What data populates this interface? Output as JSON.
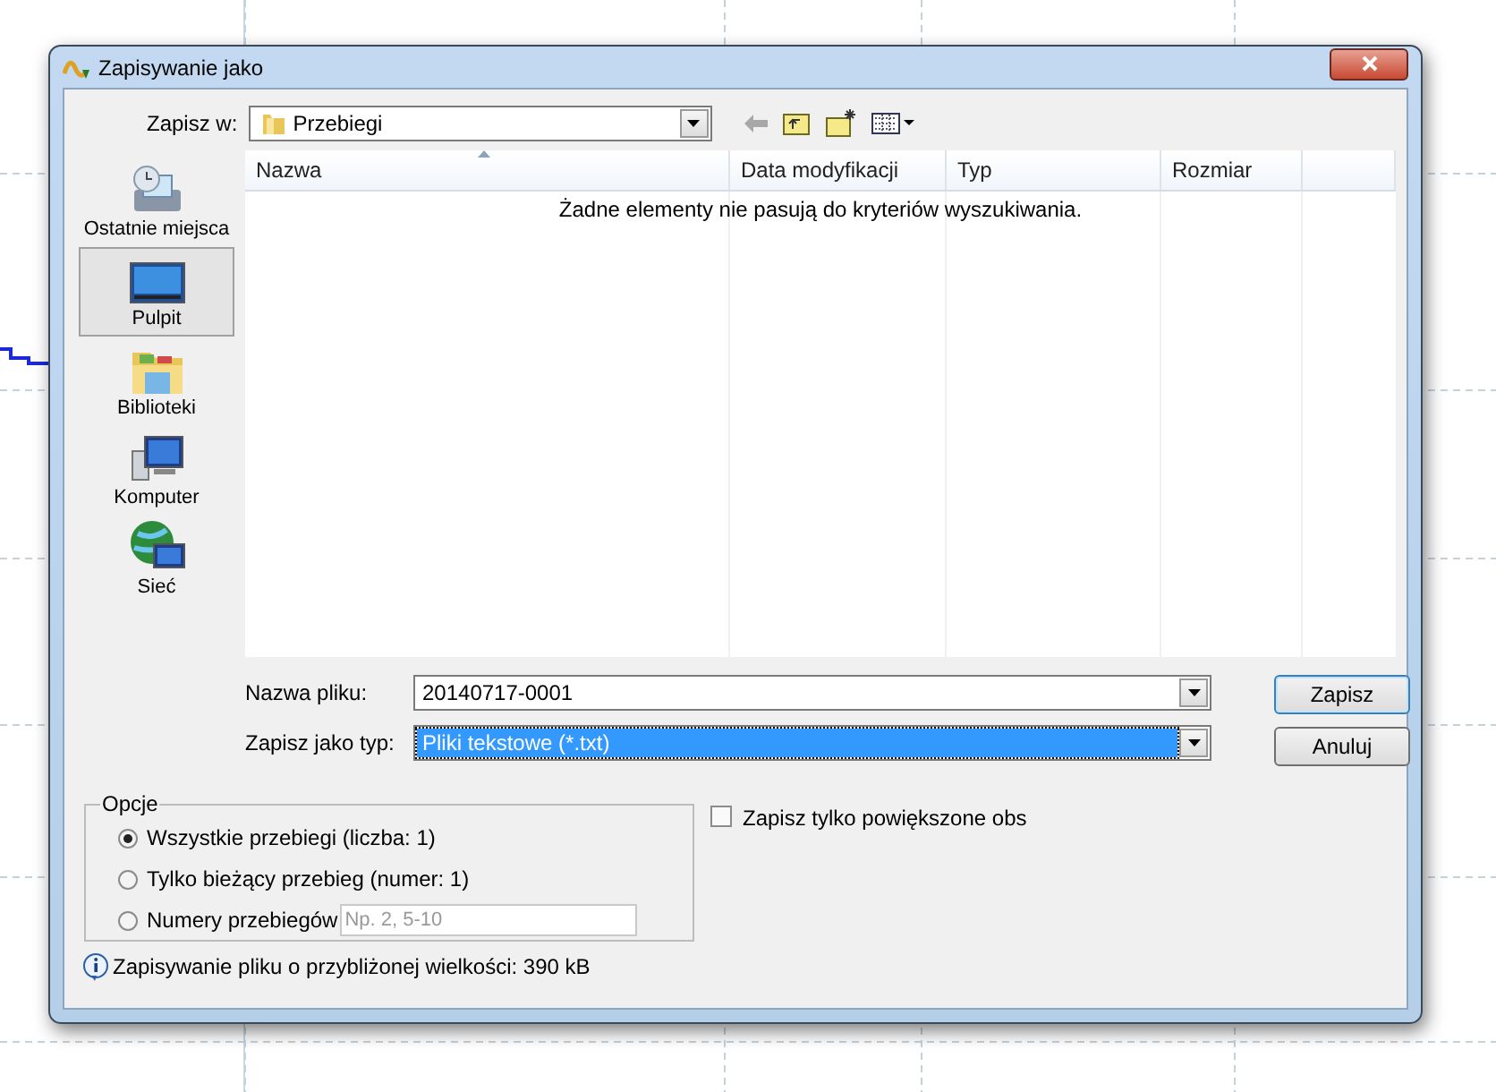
{
  "window": {
    "title": "Zapisywanie jako"
  },
  "save_in": {
    "label": "Zapisz w:",
    "value": "Przebiegi"
  },
  "places": [
    {
      "label": "Ostatnie miejsca",
      "kind": "recent",
      "selected": false
    },
    {
      "label": "Pulpit",
      "kind": "desktop",
      "selected": true
    },
    {
      "label": "Biblioteki",
      "kind": "libraries",
      "selected": false
    },
    {
      "label": "Komputer",
      "kind": "computer",
      "selected": false
    },
    {
      "label": "Sieć",
      "kind": "network",
      "selected": false
    }
  ],
  "file_list": {
    "columns": [
      {
        "label": "Nazwa",
        "sorted": true
      },
      {
        "label": "Data modyfikacji",
        "sorted": false
      },
      {
        "label": "Typ",
        "sorted": false
      },
      {
        "label": "Rozmiar",
        "sorted": false
      }
    ],
    "empty_message": "Żadne elementy nie pasują do kryteriów wyszukiwania."
  },
  "file_name": {
    "label": "Nazwa pliku:",
    "value": "20140717-0001"
  },
  "file_type": {
    "label": "Zapisz jako typ:",
    "value": "Pliki tekstowe (*.txt)",
    "focused": true
  },
  "buttons": [
    {
      "label": "Zapisz",
      "default": true
    },
    {
      "label": "Anuluj",
      "default": false
    }
  ],
  "options": {
    "title": "Opcje",
    "radios": [
      {
        "label": "Wszystkie przebiegi (liczba: 1)",
        "selected": true
      },
      {
        "label": "Tylko bieżący przebieg (numer: 1)",
        "selected": false
      },
      {
        "label": "Numery przebiegów",
        "selected": false,
        "placeholder": "Np. 2, 5-10"
      }
    ]
  },
  "zoomed_only": {
    "label": "Zapisz tylko powiększone obs",
    "checked": false
  },
  "info": "Zapisywanie pliku o przybliżonej wielkości: 390 kB"
}
